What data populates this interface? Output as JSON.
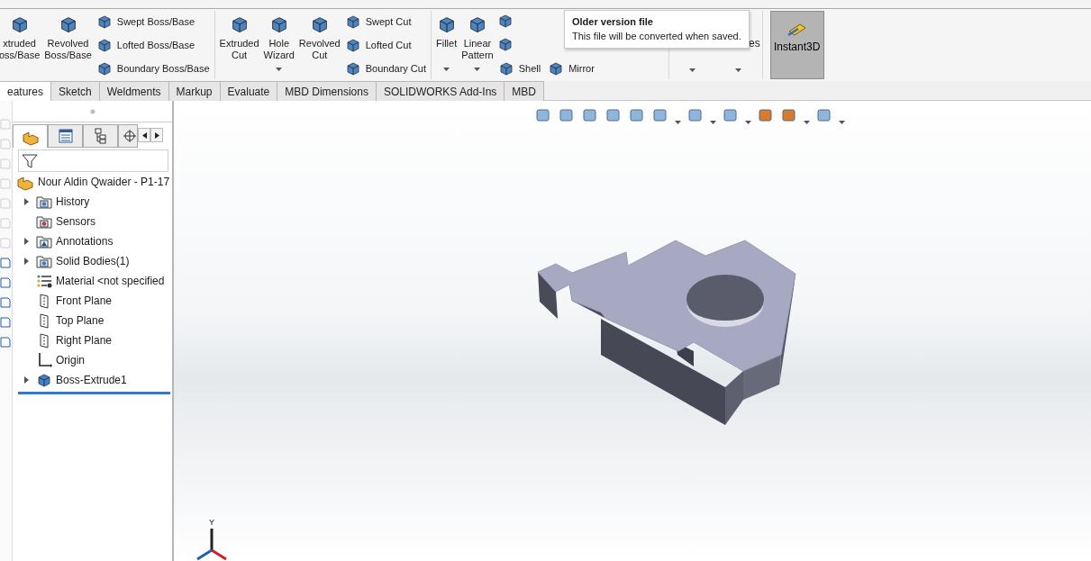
{
  "ribbon": {
    "groups": [
      {
        "kind": "commands",
        "large": [
          {
            "lines": [
              "xtruded",
              "oss/Base"
            ],
            "dropdown": false
          },
          {
            "lines": [
              "Revolved",
              "Boss/Base"
            ],
            "dropdown": false
          }
        ],
        "small": [
          {
            "label": "Swept Boss/Base"
          },
          {
            "label": "Lofted Boss/Base"
          },
          {
            "label": "Boundary Boss/Base"
          }
        ]
      },
      {
        "kind": "commands",
        "large": [
          {
            "lines": [
              "Extruded",
              "Cut"
            ],
            "dropdown": false
          },
          {
            "lines": [
              "Hole",
              "Wizard"
            ],
            "dropdown": true
          },
          {
            "lines": [
              "Revolved",
              "Cut"
            ],
            "dropdown": false
          }
        ],
        "small": [
          {
            "label": "Swept Cut"
          },
          {
            "label": "Lofted Cut"
          },
          {
            "label": "Boundary Cut"
          }
        ]
      },
      {
        "kind": "tools",
        "large": [
          {
            "lines": [
              "Fillet"
            ],
            "dropdown": true
          },
          {
            "lines": [
              "Linear",
              "Pattern"
            ],
            "dropdown": true
          }
        ],
        "small": [
          {
            "label": "Shell"
          },
          {
            "label": "Mirror"
          }
        ]
      },
      {
        "kind": "covered",
        "fragment": "es"
      }
    ],
    "instant3d": {
      "label": "Instant3D",
      "selected": true
    }
  },
  "tooltip": {
    "title": "Older version file",
    "text": "This file will be converted when saved."
  },
  "tabs": [
    {
      "label": "eatures",
      "selected": true
    },
    {
      "label": "Sketch",
      "selected": false
    },
    {
      "label": "Weldments",
      "selected": false
    },
    {
      "label": "Markup",
      "selected": false
    },
    {
      "label": "Evaluate",
      "selected": false
    },
    {
      "label": "MBD Dimensions",
      "selected": false
    },
    {
      "label": "SOLIDWORKS Add-Ins",
      "selected": false
    },
    {
      "label": "MBD",
      "selected": false
    }
  ],
  "panel": {
    "tabs": [
      {
        "kind": "tree",
        "selected": true
      },
      {
        "kind": "property",
        "selected": false
      },
      {
        "kind": "config",
        "selected": false
      },
      {
        "kind": "target",
        "selected": false
      }
    ],
    "tree": {
      "label": "Nour Aldin Qwaider - P1-17",
      "children": [
        {
          "label": "History",
          "kind": "history",
          "collapsed": true
        },
        {
          "label": "Sensors",
          "kind": "sensors",
          "collapsed": false
        },
        {
          "label": "Annotations",
          "kind": "annotations",
          "collapsed": true
        },
        {
          "label": "Solid Bodies(1)",
          "kind": "bodies",
          "collapsed": true
        },
        {
          "label": "Material <not specified",
          "kind": "material",
          "collapsed": false
        },
        {
          "label": "Front Plane",
          "kind": "plane",
          "collapsed": false
        },
        {
          "label": "Top Plane",
          "kind": "plane",
          "collapsed": false
        },
        {
          "label": "Right Plane",
          "kind": "plane",
          "collapsed": false
        },
        {
          "label": "Origin",
          "kind": "origin",
          "collapsed": false
        },
        {
          "label": "Boss-Extrude1",
          "kind": "extrude",
          "collapsed": true
        }
      ]
    }
  },
  "viewport": {
    "triad": {
      "y_label": "Y"
    }
  }
}
